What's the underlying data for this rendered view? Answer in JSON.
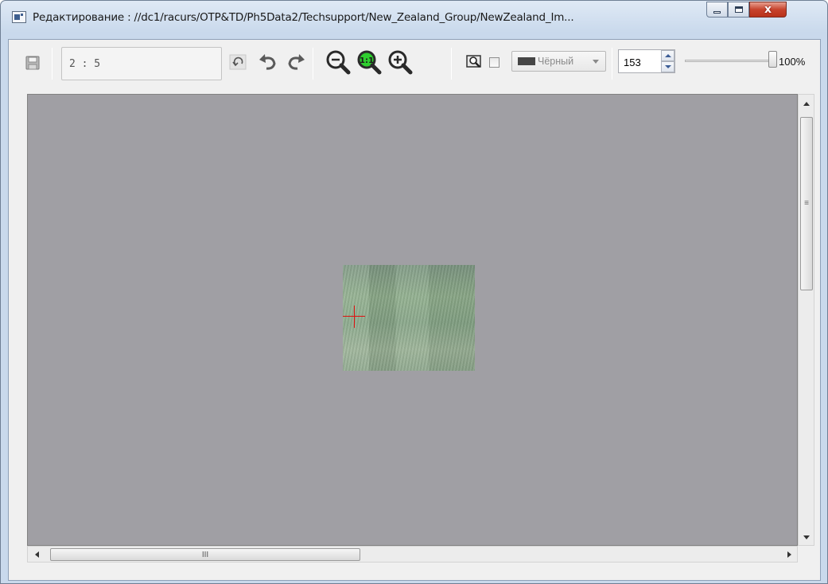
{
  "window": {
    "title": "Редактирование : //dc1/racurs/OTP&TD/Ph5Data2/Techsupport/New_Zealand_Group/NewZealand_Im...",
    "close_glyph": "x"
  },
  "toolbar": {
    "counter_value": "2 : 5",
    "color_combo": {
      "swatch_color": "#454545",
      "label": "Чёрный"
    },
    "size_value": "153",
    "zoom_label": "100%",
    "zoom_fraction": 1.0
  },
  "icons": [
    "save-icon",
    "reset-icon",
    "undo-icon",
    "redo-icon",
    "zoom-out-icon",
    "zoom-fit-icon",
    "zoom-in-icon",
    "magnifier-icon"
  ],
  "colors": {
    "canvas_bg": "#a09fa4",
    "crosshair": "#e01010",
    "zoom_fit_accent": "#2ecf2e"
  },
  "scrollbars": {
    "horizontal_grip": "III"
  }
}
